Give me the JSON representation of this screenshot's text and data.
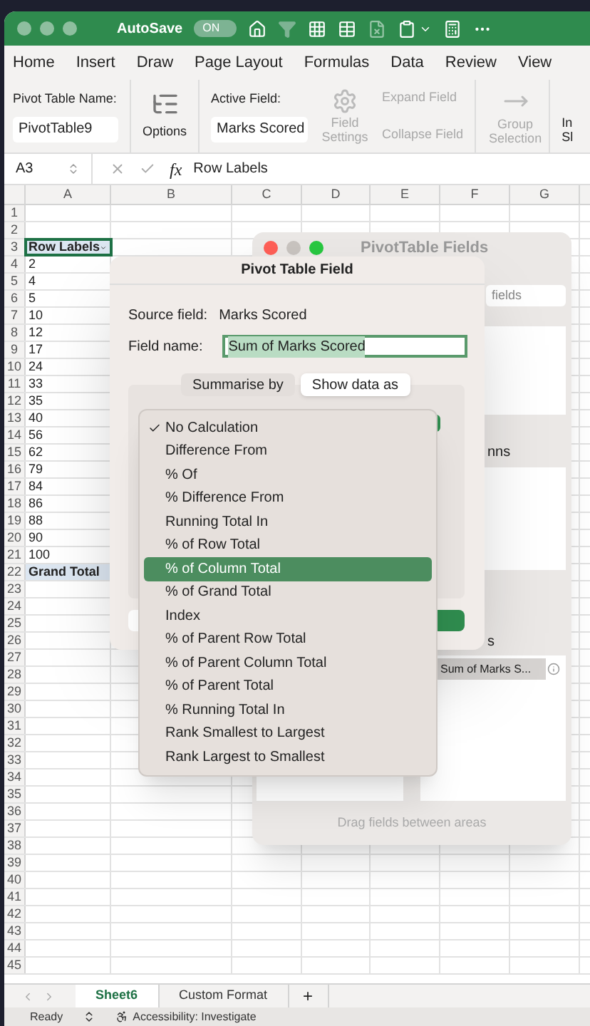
{
  "titlebar": {
    "autosave": "AutoSave",
    "toggle": {
      "label": "ON",
      "on": true
    }
  },
  "ribbon_tabs": [
    "Home",
    "Insert",
    "Draw",
    "Page Layout",
    "Formulas",
    "Data",
    "Review",
    "View"
  ],
  "ribbon": {
    "pivot_name_label": "Pivot Table Name:",
    "pivot_name_value": "PivotTable9",
    "options": "Options",
    "active_field_label": "Active Field:",
    "active_field_value": "Marks Scored",
    "commands": [
      {
        "label": "Field Settings",
        "disabled": true
      },
      {
        "label": "Expand Field",
        "disabled": true
      },
      {
        "label": "Collapse Field",
        "disabled": true
      },
      {
        "label": "Group Selection",
        "disabled": true
      }
    ],
    "cut_command": [
      "In",
      "Sl"
    ]
  },
  "formula_bar": {
    "name_box": "A3",
    "function_label": "fx",
    "content": "Row Labels"
  },
  "grid": {
    "columns": [
      "A",
      "B",
      "C",
      "D",
      "E",
      "F",
      "G"
    ],
    "rows": [
      {
        "number": "1"
      },
      {
        "number": "2"
      },
      {
        "number": "3",
        "a": "Row Labels",
        "kind": "header",
        "active": true
      },
      {
        "number": "4",
        "a": "2"
      },
      {
        "number": "5",
        "a": "4"
      },
      {
        "number": "6",
        "a": "5"
      },
      {
        "number": "7",
        "a": "10"
      },
      {
        "number": "8",
        "a": "12"
      },
      {
        "number": "9",
        "a": "17"
      },
      {
        "number": "10",
        "a": "24"
      },
      {
        "number": "11",
        "a": "33"
      },
      {
        "number": "12",
        "a": "35"
      },
      {
        "number": "13",
        "a": "40"
      },
      {
        "number": "14",
        "a": "56"
      },
      {
        "number": "15",
        "a": "62"
      },
      {
        "number": "16",
        "a": "79"
      },
      {
        "number": "17",
        "a": "84"
      },
      {
        "number": "18",
        "a": "86"
      },
      {
        "number": "19",
        "a": "88"
      },
      {
        "number": "20",
        "a": "90"
      },
      {
        "number": "21",
        "a": "100"
      },
      {
        "number": "22",
        "a": "Grand Total",
        "kind": "total"
      },
      {
        "number": "23"
      },
      {
        "number": "24"
      },
      {
        "number": "25"
      },
      {
        "number": "26"
      },
      {
        "number": "27"
      },
      {
        "number": "28"
      },
      {
        "number": "29"
      },
      {
        "number": "30"
      },
      {
        "number": "31"
      },
      {
        "number": "32"
      },
      {
        "number": "33"
      },
      {
        "number": "34"
      },
      {
        "number": "35"
      },
      {
        "number": "36"
      },
      {
        "number": "37"
      },
      {
        "number": "38"
      },
      {
        "number": "39"
      },
      {
        "number": "40"
      },
      {
        "number": "41"
      },
      {
        "number": "42"
      },
      {
        "number": "43"
      },
      {
        "number": "44"
      },
      {
        "number": "45"
      }
    ]
  },
  "fields_panel": {
    "title": "PivotTable Fields",
    "search_placeholder": "fields",
    "columns_label": "nns",
    "values_label": "s",
    "value_chip": "Sum of Marks S...",
    "footer": "Drag fields between areas"
  },
  "dialog": {
    "title": "Pivot Table Field",
    "source_label": "Source field:",
    "source_value": "Marks Scored",
    "name_label": "Field name:",
    "name_value": "Sum of Marks Scored",
    "segments": [
      {
        "label": "Summarise by",
        "selected": false
      },
      {
        "label": "Show data as",
        "selected": true
      }
    ]
  },
  "menu": [
    {
      "label": "No Calculation",
      "checked": true,
      "selected": false
    },
    {
      "label": "Difference From",
      "checked": false,
      "selected": false
    },
    {
      "label": "% Of",
      "checked": false,
      "selected": false
    },
    {
      "label": "% Difference From",
      "checked": false,
      "selected": false
    },
    {
      "label": "Running Total In",
      "checked": false,
      "selected": false
    },
    {
      "label": "% of Row Total",
      "checked": false,
      "selected": false
    },
    {
      "label": "% of Column Total",
      "checked": false,
      "selected": true
    },
    {
      "label": "% of Grand Total",
      "checked": false,
      "selected": false
    },
    {
      "label": "Index",
      "checked": false,
      "selected": false
    },
    {
      "label": "% of Parent Row Total",
      "checked": false,
      "selected": false
    },
    {
      "label": "% of Parent Column Total",
      "checked": false,
      "selected": false
    },
    {
      "label": "% of Parent Total",
      "checked": false,
      "selected": false
    },
    {
      "label": "% Running Total In",
      "checked": false,
      "selected": false
    },
    {
      "label": "Rank Smallest to Largest",
      "checked": false,
      "selected": false
    },
    {
      "label": "Rank Largest to Smallest",
      "checked": false,
      "selected": false
    }
  ],
  "sheet_tabs": [
    {
      "label": "Sheet6",
      "selected": true
    },
    {
      "label": "Custom Format",
      "selected": false
    }
  ],
  "add_sheet": "+",
  "status_bar": {
    "ready": "Ready",
    "accessibility": "Accessibility: Investigate"
  }
}
